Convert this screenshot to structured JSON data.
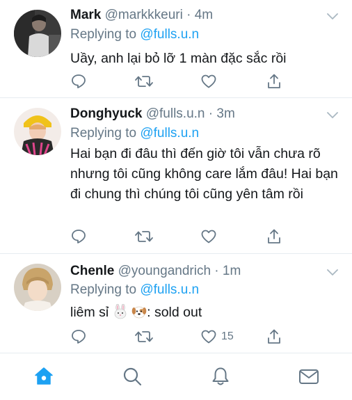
{
  "tweets": [
    {
      "name": "Mark",
      "handle": "@markkkeuri",
      "time": "4m",
      "replying_prefix": "Replying to",
      "replying_to": "@fulls.u.n",
      "text": "Uầy, anh lại bỏ lỡ 1 màn đặc sắc rồi",
      "likes": ""
    },
    {
      "name": "Donghyuck",
      "handle": "@fulls.u.n",
      "time": "3m",
      "replying_prefix": "Replying to",
      "replying_to": "@fulls.u.n",
      "text": "Hai bạn đi đâu thì đến giờ tôi vẫn chưa rõ nhưng tôi cũng không care lắm đâu! Hai bạn đi chung thì chúng tôi cũng yên tâm rồi",
      "likes": ""
    },
    {
      "name": "Chenle",
      "handle": "@youngandrich",
      "time": "1m",
      "replying_prefix": "Replying to",
      "replying_to": "@fulls.u.n",
      "text_before": "liêm sỉ",
      "text_after": ": sold out",
      "likes": "15"
    }
  ],
  "icons": {
    "reply": "reply-icon",
    "retweet": "retweet-icon",
    "like": "heart-icon",
    "share": "share-icon",
    "menu": "chevron-down-icon",
    "nav": [
      "home-icon",
      "search-icon",
      "notifications-icon",
      "messages-icon"
    ]
  },
  "colors": {
    "accent": "#1da1f2",
    "secondary_text": "#657786",
    "icon_gray": "#657786",
    "divider": "#e6ecf0"
  }
}
